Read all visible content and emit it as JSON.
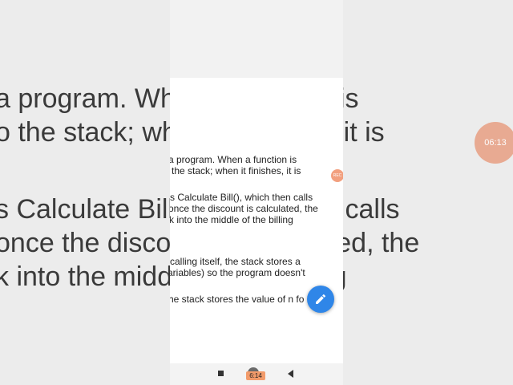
{
  "background": {
    "lines": [
      "a program. When a function is",
      "o the stack; when it finishes, it is",
      "s Calculate Bill(), which then calls",
      "once the discount is calculated, the",
      "k into the middle of the billing"
    ],
    "badge_text": "06:13"
  },
  "document": {
    "lines": [
      "a program. When a function is",
      "o the stack; when it finishes, it is",
      "s Calculate Bill(), which then calls",
      "once the discount is calculated, the",
      "k into the middle of the billing",
      "calling itself, the stack stores a",
      "ariables) so the program doesn't",
      "he stack stores the value of n fo"
    ]
  },
  "recording_badge": "REC",
  "nav": {
    "time_label": "6:14"
  },
  "colors": {
    "fab": "#2f86e8",
    "record": "#f2a07f"
  }
}
